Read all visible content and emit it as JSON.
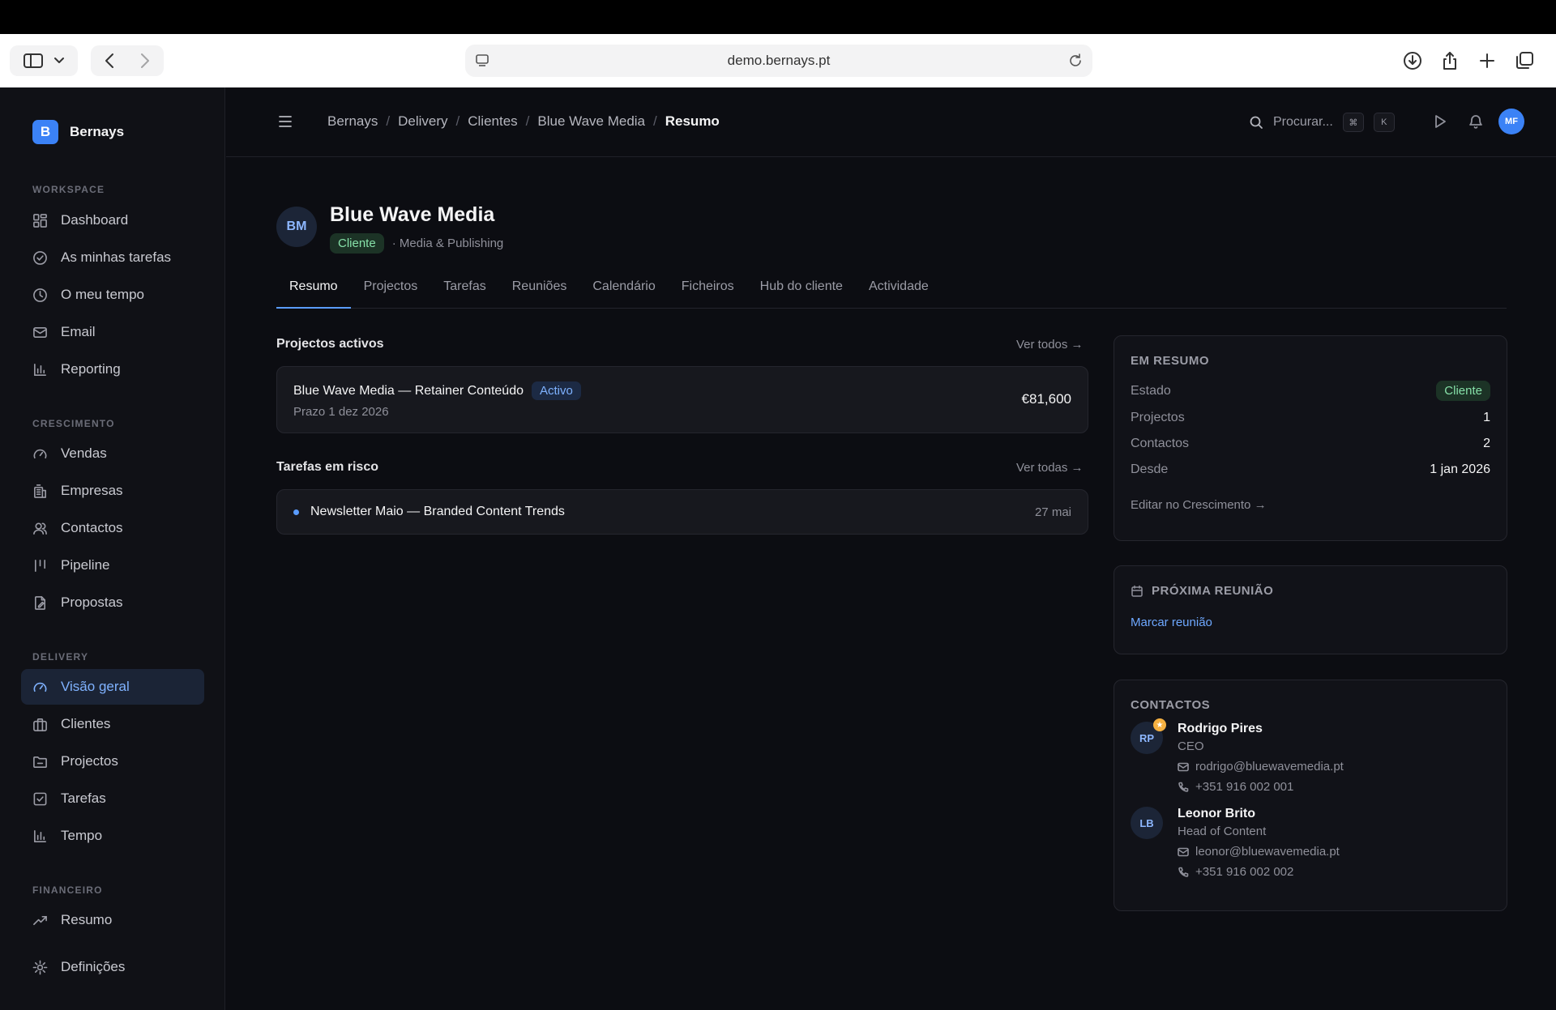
{
  "browser": {
    "url": "demo.bernays.pt"
  },
  "sidebar": {
    "brand_initial": "B",
    "brand_name": "Bernays",
    "sections": {
      "workspace": "WORKSPACE",
      "crescimento": "CRESCIMENTO",
      "delivery": "DELIVERY",
      "financeiro": "FINANCEIRO"
    },
    "items": {
      "dashboard": "Dashboard",
      "tarefas_minhas": "As minhas tarefas",
      "tempo_meu": "O meu tempo",
      "email": "Email",
      "reporting": "Reporting",
      "vendas": "Vendas",
      "empresas": "Empresas",
      "contactos": "Contactos",
      "pipeline": "Pipeline",
      "propostas": "Propostas",
      "visao_geral": "Visão geral",
      "clientes": "Clientes",
      "projectos": "Projectos",
      "tarefas": "Tarefas",
      "tempo": "Tempo",
      "resumo": "Resumo",
      "definicoes": "Definições"
    },
    "active": "visao_geral"
  },
  "header": {
    "breadcrumb": [
      "Bernays",
      "Delivery",
      "Clientes",
      "Blue Wave Media",
      "Resumo"
    ],
    "search_placeholder": "Procurar...",
    "kbd_1": "⌘",
    "kbd_2": "K",
    "user_initials": "MF"
  },
  "client": {
    "initials": "BM",
    "name": "Blue Wave Media",
    "status": "Cliente",
    "industry": "· Media & Publishing"
  },
  "tabs": [
    "Resumo",
    "Projectos",
    "Tarefas",
    "Reuniões",
    "Calendário",
    "Ficheiros",
    "Hub do cliente",
    "Actividade"
  ],
  "projects": {
    "title": "Projectos activos",
    "see_all": "Ver todos →",
    "items": [
      {
        "name": "Blue Wave Media — Retainer Conteúdo",
        "status": "Activo",
        "deadline": "Prazo 1 dez 2026",
        "value": "€81,600"
      }
    ]
  },
  "risk_tasks": {
    "title": "Tarefas em risco",
    "see_all": "Ver todas →",
    "items": [
      {
        "name": "Newsletter Maio — Branded Content Trends",
        "date": "27 mai"
      }
    ]
  },
  "summary": {
    "title": "EM RESUMO",
    "rows": [
      {
        "k": "Estado",
        "v": "Cliente"
      },
      {
        "k": "Projectos",
        "v": "1"
      },
      {
        "k": "Contactos",
        "v": "2"
      },
      {
        "k": "Desde",
        "v": "1 jan 2026"
      }
    ],
    "edit_link": "Editar no Crescimento →"
  },
  "meeting": {
    "title": "PRÓXIMA REUNIÃO",
    "link": "Marcar reunião"
  },
  "contacts": {
    "title": "CONTACTOS",
    "items": [
      {
        "initials": "RP",
        "name": "Rodrigo Pires",
        "role": "CEO",
        "email": "rodrigo@bluewavemedia.pt",
        "phone": "+351 916 002 001",
        "primary": true
      },
      {
        "initials": "LB",
        "name": "Leonor Brito",
        "role": "Head of Content",
        "email": "leonor@bluewavemedia.pt",
        "phone": "+351 916 002 002",
        "primary": false
      }
    ]
  }
}
